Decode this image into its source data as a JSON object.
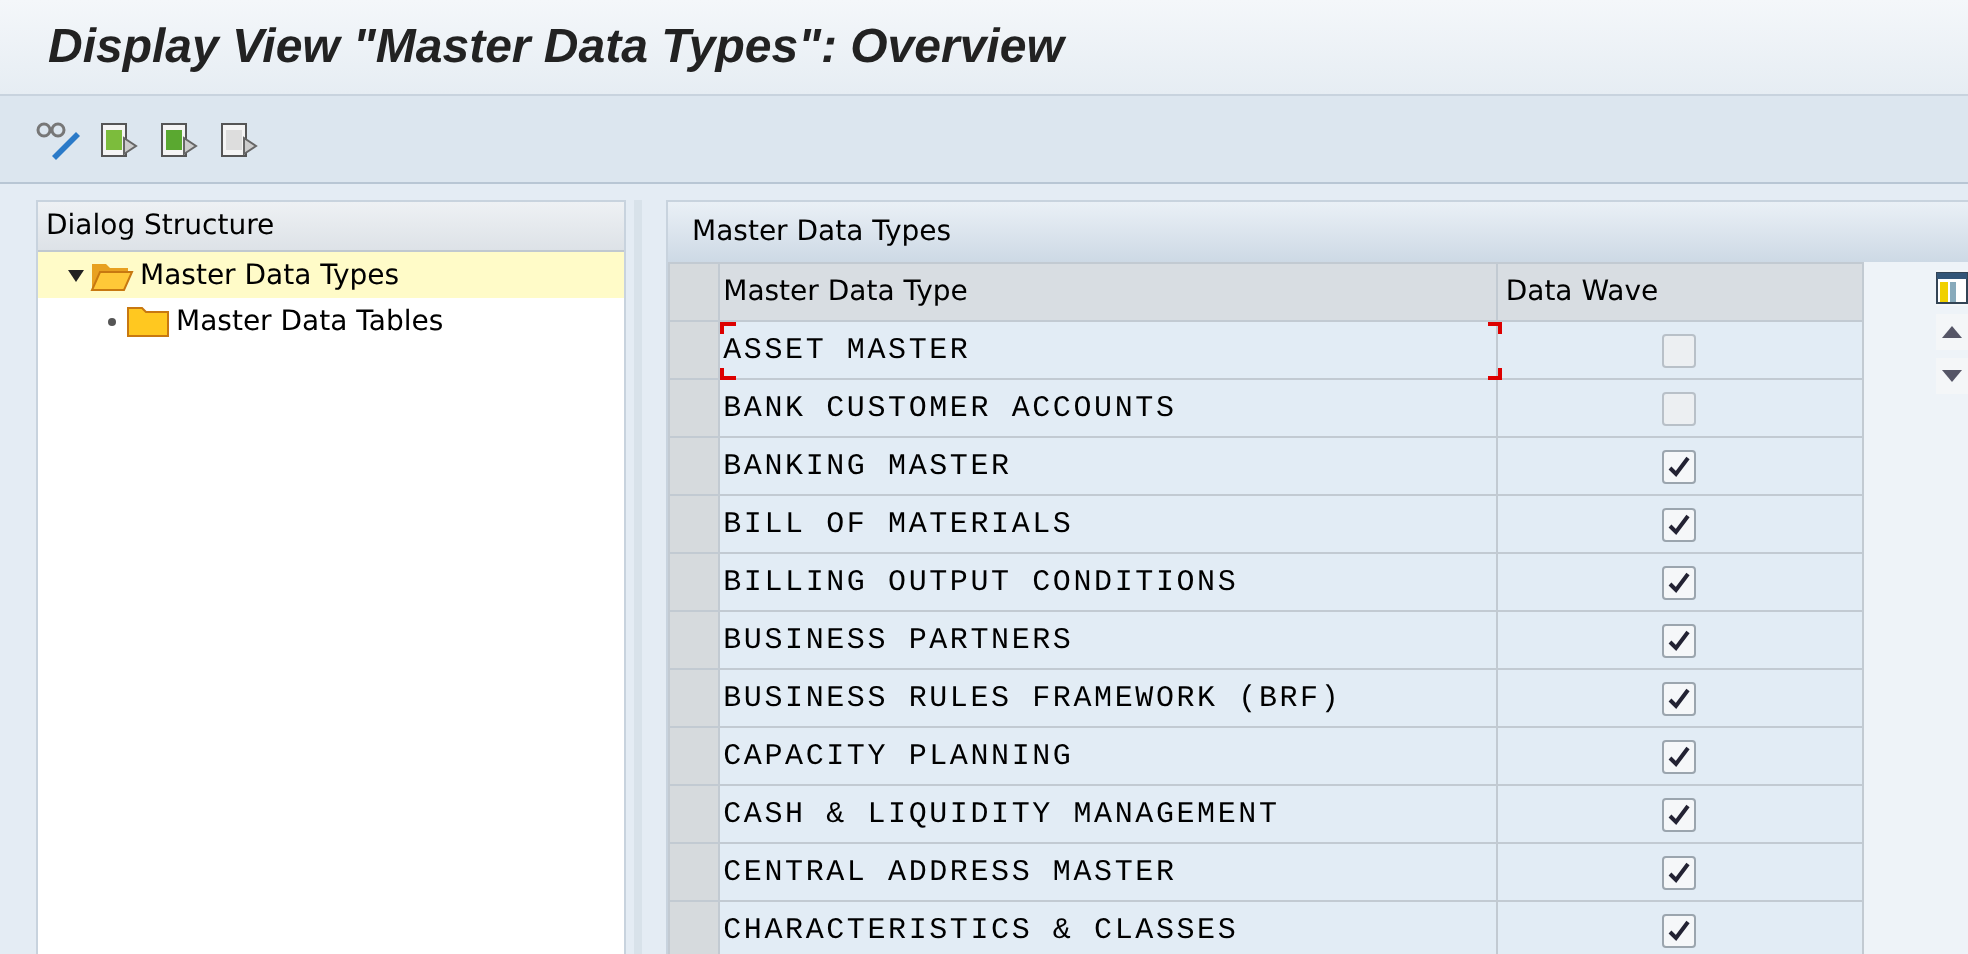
{
  "window": {
    "title": "Display View \"Master Data Types\": Overview"
  },
  "dialog_structure": {
    "title": "Dialog Structure",
    "items": [
      {
        "label": "Master Data Types",
        "selected": true,
        "expanded": true,
        "children": [
          {
            "label": "Master Data Tables",
            "selected": false,
            "expanded": false
          }
        ]
      }
    ]
  },
  "table": {
    "title": "Master Data Types",
    "columns": [
      "Master Data Type",
      "Data Wave"
    ],
    "rows": [
      {
        "type": "ASSET MASTER",
        "data_wave": false,
        "focused": true
      },
      {
        "type": "BANK CUSTOMER ACCOUNTS",
        "data_wave": false,
        "focused": false
      },
      {
        "type": "BANKING MASTER",
        "data_wave": true,
        "focused": false
      },
      {
        "type": "BILL OF MATERIALS",
        "data_wave": true,
        "focused": false
      },
      {
        "type": "BILLING OUTPUT CONDITIONS",
        "data_wave": true,
        "focused": false
      },
      {
        "type": "BUSINESS PARTNERS",
        "data_wave": true,
        "focused": false
      },
      {
        "type": "BUSINESS RULES FRAMEWORK (BRF)",
        "data_wave": true,
        "focused": false
      },
      {
        "type": "CAPACITY PLANNING",
        "data_wave": true,
        "focused": false
      },
      {
        "type": "CASH & LIQUIDITY MANAGEMENT",
        "data_wave": true,
        "focused": false
      },
      {
        "type": "CENTRAL ADDRESS MASTER",
        "data_wave": true,
        "focused": false
      },
      {
        "type": "CHARACTERISTICS & CLASSES",
        "data_wave": true,
        "focused": false
      }
    ]
  }
}
